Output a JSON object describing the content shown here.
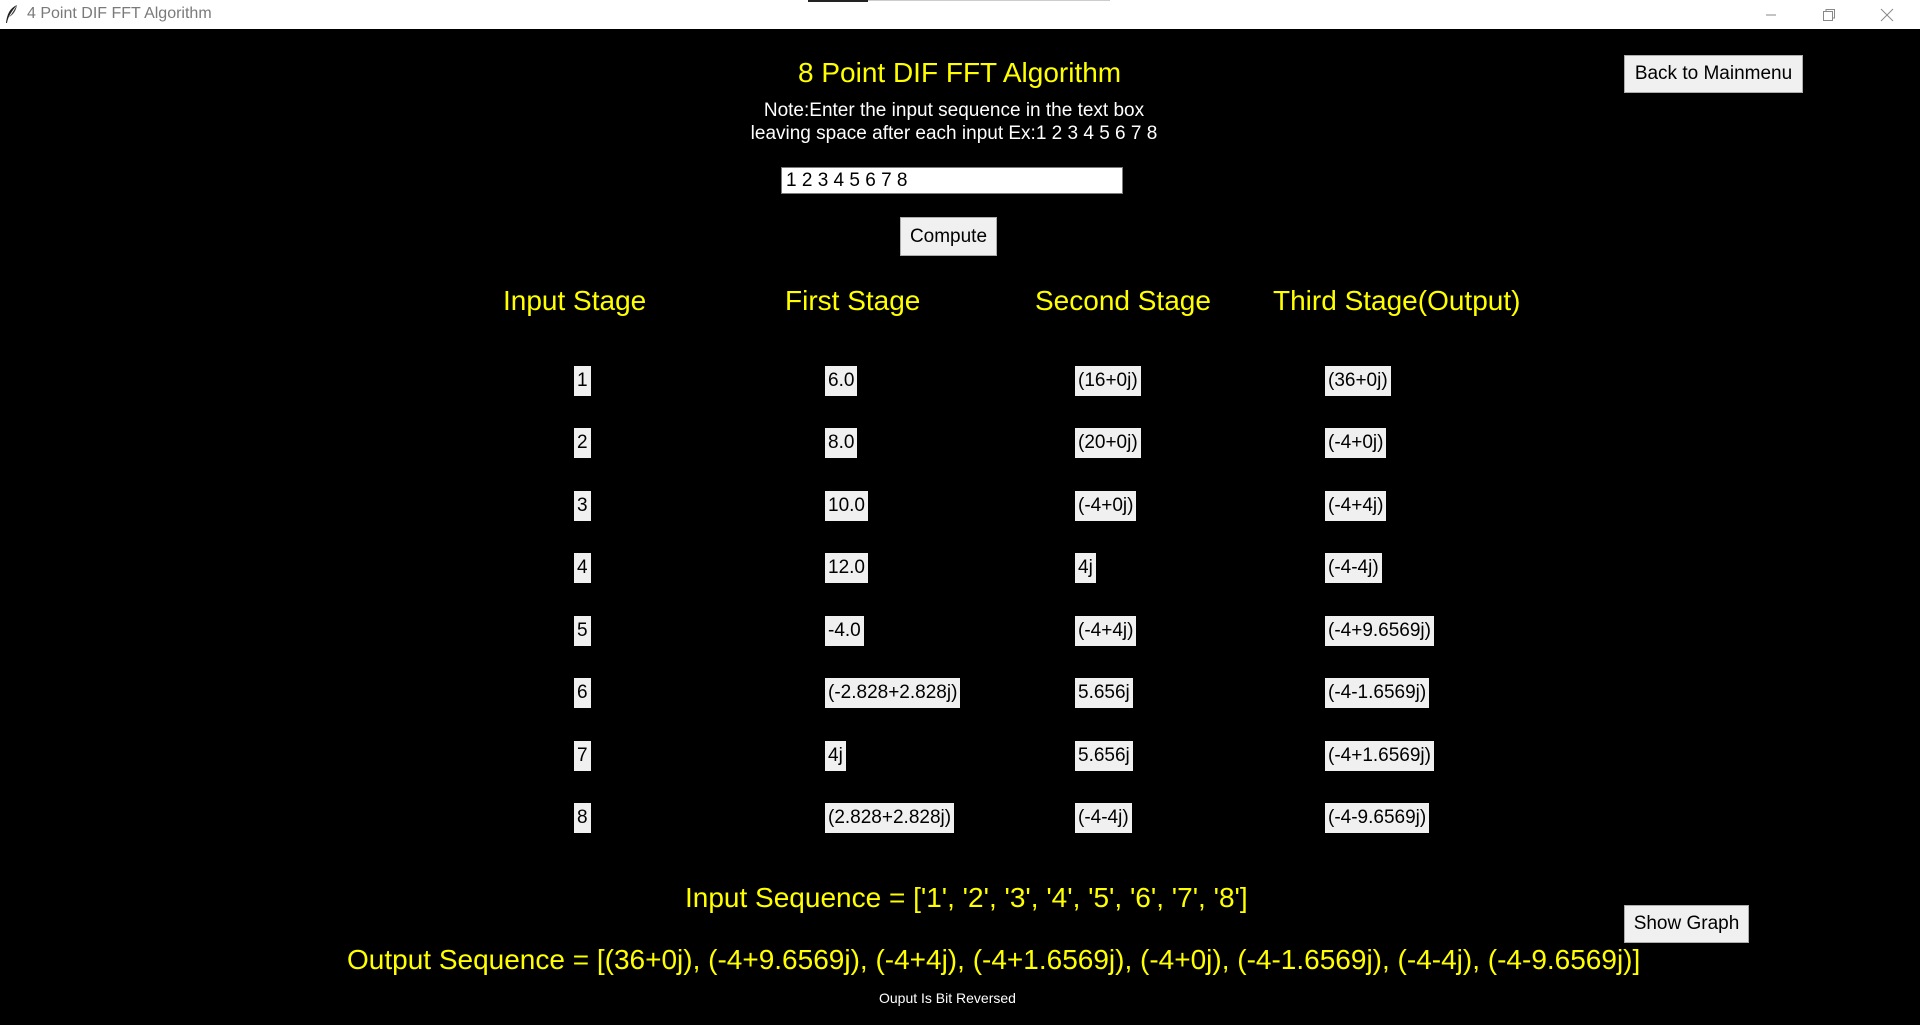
{
  "window": {
    "title": "4 Point DIF FFT Algorithm",
    "icon": "feather-icon"
  },
  "header": {
    "title": "8 Point DIF FFT Algorithm",
    "note_line1": "Note:Enter the input sequence in the text box",
    "note_line2": "leaving space after each input Ex:1 2 3 4 5 6 7 8",
    "back_button": "Back to Mainmenu"
  },
  "input": {
    "value": "1 2 3 4 5 6 7 8"
  },
  "compute_button": "Compute",
  "stages": {
    "headers": [
      "Input Stage",
      "First Stage",
      "Second Stage",
      "Third Stage(Output)"
    ],
    "input": [
      "1",
      "2",
      "3",
      "4",
      "5",
      "6",
      "7",
      "8"
    ],
    "first": [
      "6.0",
      "8.0",
      "10.0",
      "12.0",
      "-4.0",
      "(-2.828+2.828j)",
      "4j",
      "(2.828+2.828j)"
    ],
    "second": [
      "(16+0j)",
      "(20+0j)",
      "(-4+0j)",
      "4j",
      "(-4+4j)",
      "5.656j",
      "5.656j",
      "(-4-4j)"
    ],
    "third": [
      "(36+0j)",
      "(-4+0j)",
      "(-4+4j)",
      "(-4-4j)",
      "(-4+9.6569j)",
      "(-4-1.6569j)",
      "(-4+1.6569j)",
      "(-4-9.6569j)"
    ]
  },
  "results": {
    "input_sequence": "Input Sequence = ['1', '2', '3', '4', '5', '6', '7', '8']",
    "output_sequence": "Output Sequence = [(36+0j), (-4+9.6569j), (-4+4j), (-4+1.6569j), (-4+0j), (-4-1.6569j), (-4-4j), (-4-9.6569j)]",
    "footnote": "Ouput Is Bit Reversed",
    "show_graph_button": "Show Graph"
  },
  "colors": {
    "background": "#000000",
    "accent_text": "#ffff00",
    "note_text": "#ffffff"
  }
}
